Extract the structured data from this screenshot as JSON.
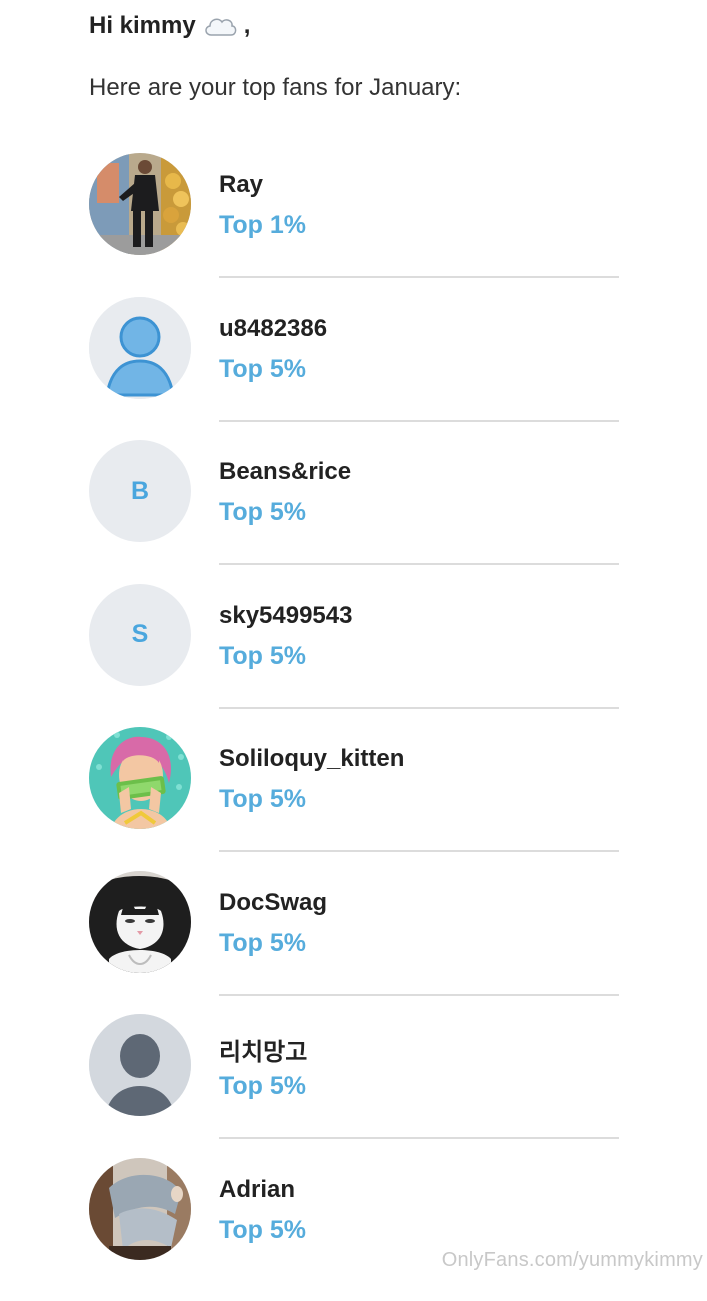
{
  "greeting": {
    "text": "Hi kimmy",
    "icon": "cloud-icon",
    "suffix": ","
  },
  "intro": "Here are your top fans for January:",
  "fans": [
    {
      "name": "Ray",
      "rank": "Top 1%",
      "avatar": "photo-man-mural"
    },
    {
      "name": "u8482386",
      "rank": "Top 5%",
      "avatar": "default-user-icon-blue"
    },
    {
      "name": "Beans&rice",
      "rank": "Top 5%",
      "avatar_letter": "B"
    },
    {
      "name": "sky5499543",
      "rank": "Top 5%",
      "avatar_letter": "S"
    },
    {
      "name": "Soliloquy_kitten",
      "rank": "Top 5%",
      "avatar": "pop-art-woman-money"
    },
    {
      "name": "DocSwag",
      "rank": "Top 5%",
      "avatar": "photo-cat"
    },
    {
      "name": "리치망고",
      "rank": "Top 5%",
      "avatar": "default-user-icon-gray"
    },
    {
      "name": "Adrian",
      "rank": "Top 5%",
      "avatar": "photo-person-legs"
    }
  ],
  "watermark": "OnlyFans.com/yummykimmy",
  "colors": {
    "accent": "#56acdc",
    "text": "#222222",
    "divider": "#dcdcdc",
    "avatar_bg": "#e8ebef"
  }
}
